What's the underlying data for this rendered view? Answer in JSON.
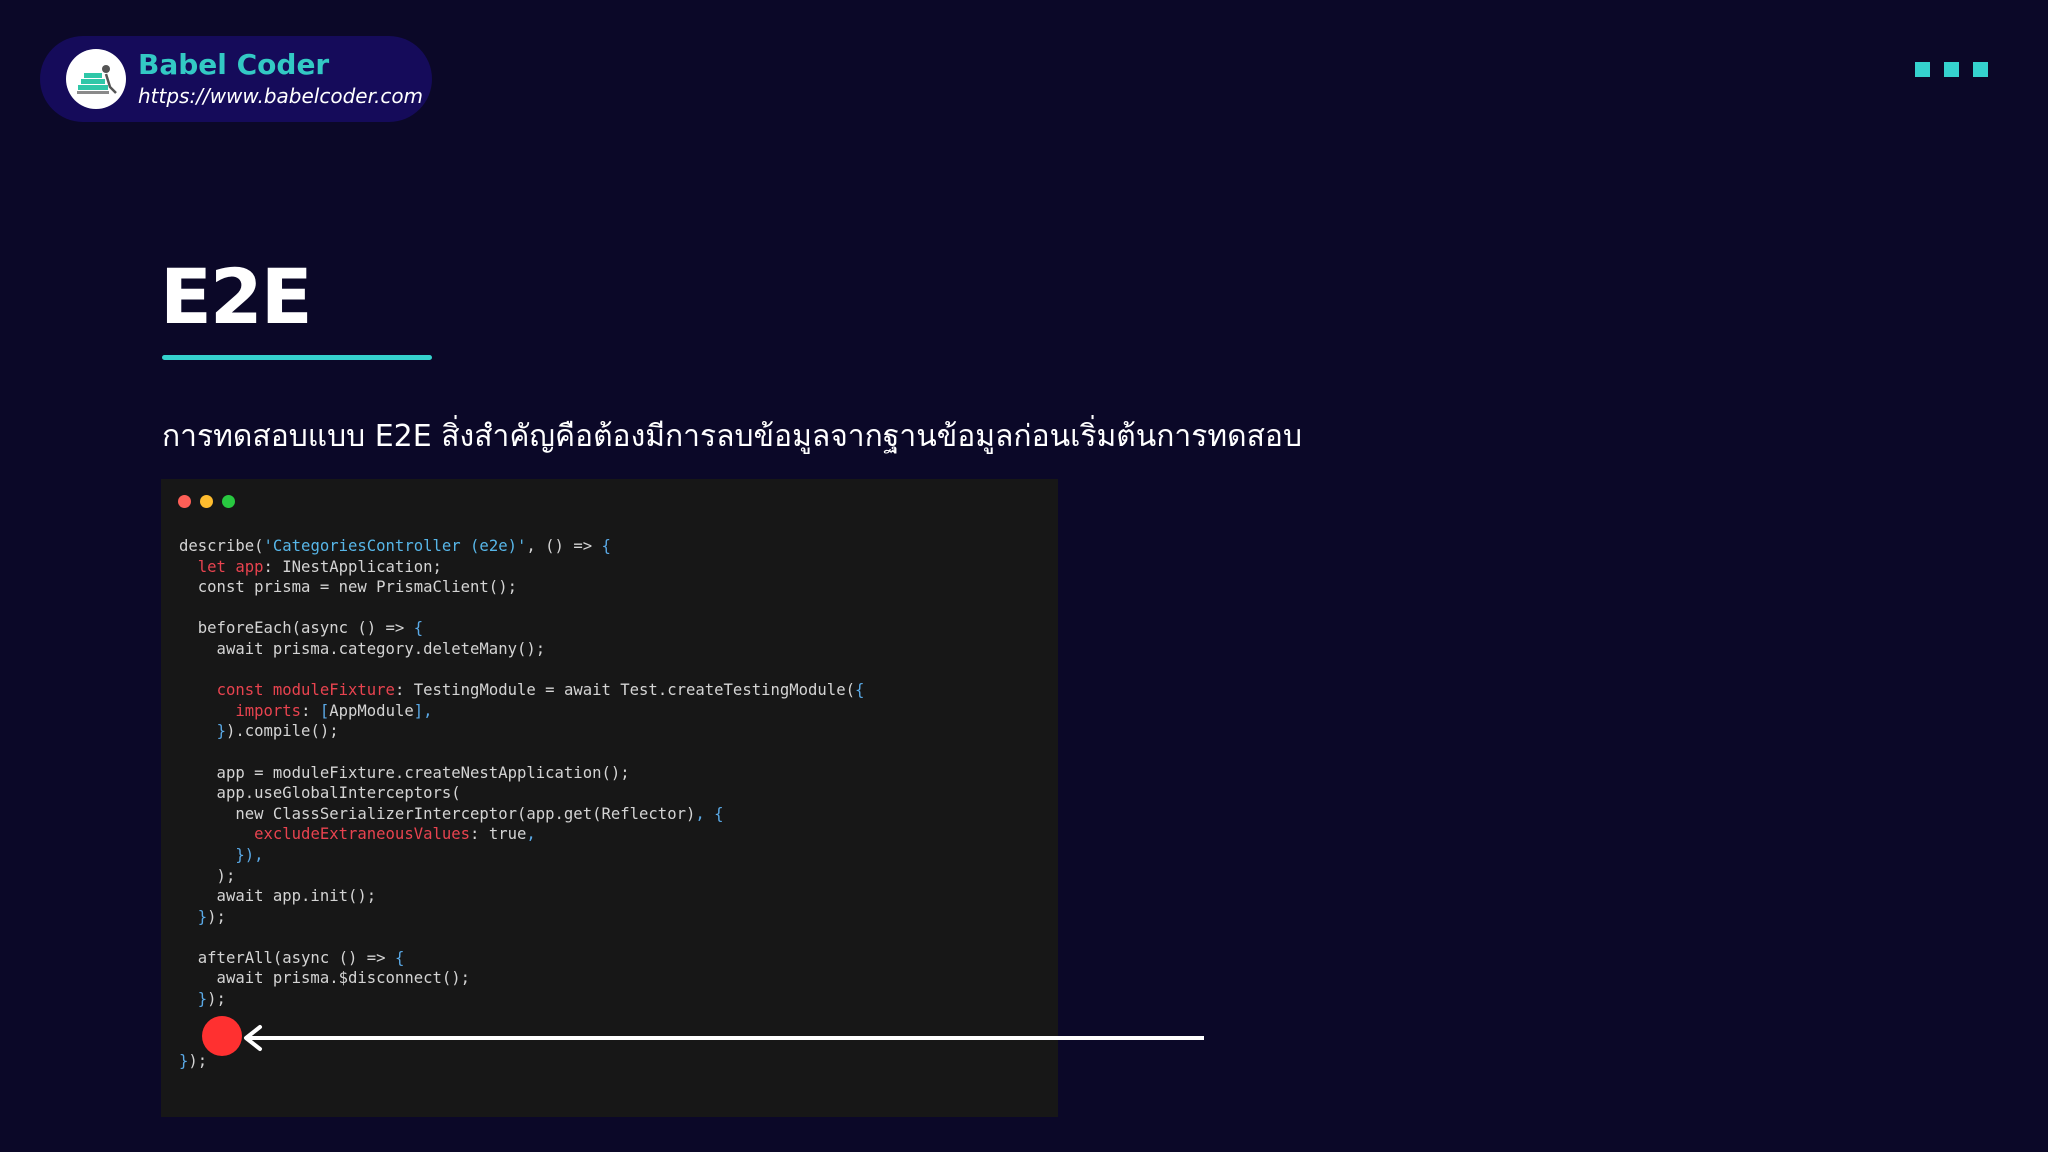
{
  "brand": {
    "name": "Babel Coder",
    "url": "https://www.babelcoder.com",
    "logo_icon": "babel-coder-logo"
  },
  "menu": {
    "icon": "three-squares-menu-icon",
    "color": "#35d2ce"
  },
  "slide": {
    "title": "E2E",
    "subtitle": "การทดสอบแบบ E2E สิ่งสำคัญคือต้องมีการลบข้อมูลจากฐานข้อมูลก่อนเริ่มต้นการทดสอบ"
  },
  "colors": {
    "background": "#0b0828",
    "brand_pill": "#150b5a",
    "accent": "#35d2ce",
    "code_bg": "#171717",
    "marker": "#ff3030"
  },
  "code_window": {
    "buttons": [
      "close",
      "minimize",
      "maximize"
    ],
    "lines": [
      [
        [
          "describe(",
          "p"
        ],
        [
          "'CategoriesController (e2e)'",
          "s"
        ],
        [
          ", () => ",
          "p"
        ],
        [
          "{",
          "u"
        ]
      ],
      [
        [
          "  ",
          "p"
        ],
        [
          "let app",
          "k"
        ],
        [
          ": INestApplication;",
          "p"
        ]
      ],
      [
        [
          "  const prisma = new PrismaClient();",
          "p"
        ]
      ],
      [
        [
          "",
          "p"
        ]
      ],
      [
        [
          "  beforeEach(async () => ",
          "p"
        ],
        [
          "{",
          "u"
        ]
      ],
      [
        [
          "    await prisma.category.deleteMany();",
          "p"
        ]
      ],
      [
        [
          "",
          "p"
        ]
      ],
      [
        [
          "    ",
          "p"
        ],
        [
          "const moduleFixture",
          "k"
        ],
        [
          ": TestingModule = await Test.createTestingModule(",
          "p"
        ],
        [
          "{",
          "u"
        ]
      ],
      [
        [
          "      ",
          "p"
        ],
        [
          "imports",
          "k"
        ],
        [
          ": ",
          "p"
        ],
        [
          "[",
          "u"
        ],
        [
          "AppModule",
          "p"
        ],
        [
          "],",
          "u"
        ]
      ],
      [
        [
          "    ",
          "p"
        ],
        [
          "}",
          "u"
        ],
        [
          ").compile();",
          "p"
        ]
      ],
      [
        [
          "",
          "p"
        ]
      ],
      [
        [
          "    app = moduleFixture.createNestApplication();",
          "p"
        ]
      ],
      [
        [
          "    app.useGlobalInterceptors(",
          "p"
        ]
      ],
      [
        [
          "      new ClassSerializerInterceptor(app.get(Reflector)",
          "p"
        ],
        [
          ", {",
          "u"
        ]
      ],
      [
        [
          "        ",
          "p"
        ],
        [
          "excludeExtraneousValues",
          "k"
        ],
        [
          ": true",
          "p"
        ],
        [
          ",",
          "u"
        ]
      ],
      [
        [
          "      ",
          "p"
        ],
        [
          "}),",
          "u"
        ]
      ],
      [
        [
          "    );",
          "p"
        ]
      ],
      [
        [
          "    await app.init();",
          "p"
        ]
      ],
      [
        [
          "  ",
          "p"
        ],
        [
          "}",
          "u"
        ],
        [
          ");",
          "p"
        ]
      ],
      [
        [
          "",
          "p"
        ]
      ],
      [
        [
          "  afterAll(async () => ",
          "p"
        ],
        [
          "{",
          "u"
        ]
      ],
      [
        [
          "    await prisma.$disconnect();",
          "p"
        ]
      ],
      [
        [
          "  ",
          "p"
        ],
        [
          "}",
          "u"
        ],
        [
          ");",
          "p"
        ]
      ],
      [
        [
          "",
          "p"
        ]
      ],
      [
        [
          "",
          "p"
        ]
      ],
      [
        [
          "",
          "p"
        ],
        [
          "}",
          "u"
        ],
        [
          ");",
          "p"
        ]
      ]
    ]
  },
  "annotation": {
    "marker_icon": "red-circle-marker",
    "arrow_icon": "left-arrow-icon"
  }
}
